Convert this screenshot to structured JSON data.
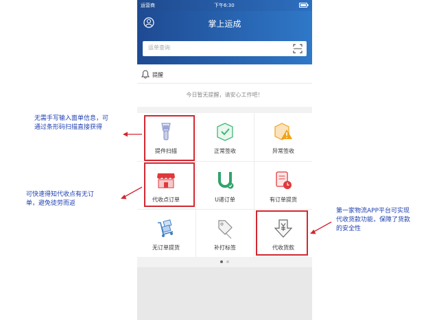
{
  "status_bar": {
    "carrier": "运营商",
    "time": "下午6:30"
  },
  "header": {
    "title": "掌上运成"
  },
  "search": {
    "placeholder": "运单查询"
  },
  "reminder": {
    "title": "提醒",
    "message": "今日暂无提醒，请安心工作吧！"
  },
  "grid": {
    "items": [
      {
        "label": "提件扫描",
        "icon": "barcode-scanner-icon"
      },
      {
        "label": "正常签收",
        "icon": "box-check-icon"
      },
      {
        "label": "异常签收",
        "icon": "box-warning-icon"
      },
      {
        "label": "代收点订单",
        "icon": "storefront-icon"
      },
      {
        "label": "U递订单",
        "icon": "u-delivery-icon"
      },
      {
        "label": "有订单提货",
        "icon": "order-clock-icon"
      },
      {
        "label": "无订单提货",
        "icon": "hand-truck-icon"
      },
      {
        "label": "补打标签",
        "icon": "tag-icon"
      },
      {
        "label": "代收货款",
        "icon": "yuan-down-icon"
      }
    ]
  },
  "pager": {
    "total": 2,
    "active": 1
  },
  "annotations": {
    "scan": [
      "无需手写输入面单信息，可",
      "通过条形码扫描直接获得"
    ],
    "collection_point": [
      "可快速得知代收点有无订",
      "单，避免徒劳而返"
    ],
    "cod": [
      "第一家物流APP平台可实现",
      "代收货款功能，保障了货款",
      "的安全性"
    ]
  },
  "colors": {
    "header_blue": "#2a63b0",
    "highlight_red": "#d3252f",
    "callout_blue": "#1e3fb0",
    "accent_green": "#3fb874",
    "accent_orange": "#f0a21a",
    "accent_red": "#e0393c"
  }
}
